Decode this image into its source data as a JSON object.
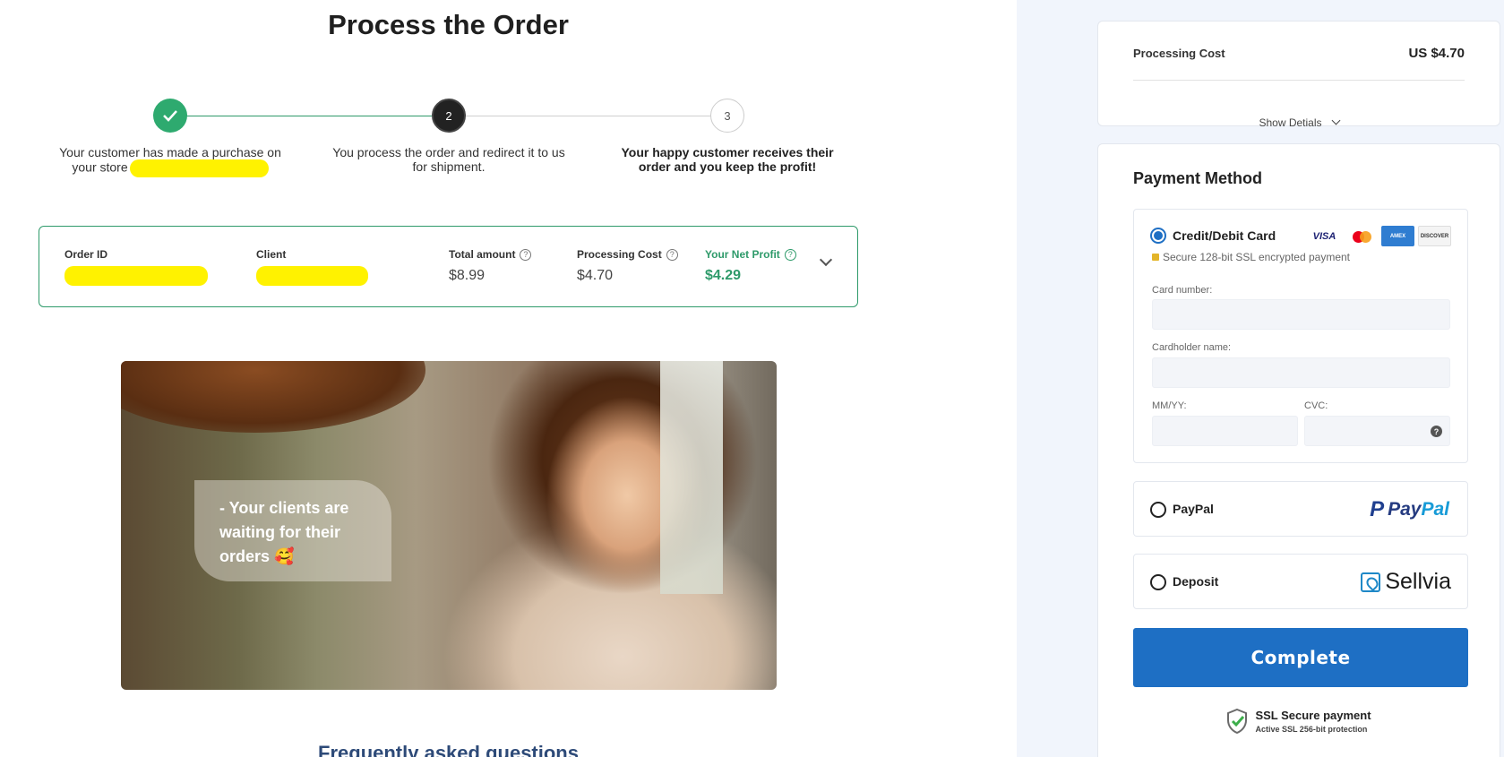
{
  "page": {
    "title": "Process the Order",
    "faq_title": "Frequently asked questions"
  },
  "stepper": {
    "steps": [
      {
        "marker": "✓",
        "text": "Your customer has made a purchase on your store"
      },
      {
        "marker": "2",
        "text": "You process the order and redirect it to us for shipment."
      },
      {
        "marker": "3",
        "text": "Your happy customer receives their order and you keep the profit!"
      }
    ]
  },
  "order": {
    "order_id_label": "Order ID",
    "client_label": "Client",
    "total_label": "Total amount",
    "total_value": "$8.99",
    "processing_label": "Processing Cost",
    "processing_value": "$4.70",
    "profit_label": "Your Net Profit",
    "profit_value": "$4.29"
  },
  "hero": {
    "bubble_text": "- Your clients are waiting for their orders 🥰"
  },
  "summary": {
    "cost_label": "Processing Cost",
    "cost_value": "US $4.70",
    "details_label": "Show Detials"
  },
  "payment": {
    "title": "Payment Method",
    "card": {
      "name": "Credit/Debit Card",
      "secure_text": "Secure 128-bit SSL encrypted payment",
      "brands": [
        "VISA",
        "Mastercard",
        "American Express",
        "DISCOVER"
      ],
      "card_number_label": "Card number:",
      "card_number_value": "",
      "holder_label": "Cardholder name:",
      "holder_value": "",
      "expiry_label": "MM/YY:",
      "expiry_value": "",
      "cvc_label": "CVC:",
      "cvc_value": "",
      "cvc_help": "?"
    },
    "paypal": {
      "name": "PayPal",
      "logo_pay": "Pay",
      "logo_pal": "Pal"
    },
    "deposit": {
      "name": "Deposit",
      "logo_text": "Sellvia"
    },
    "selected": "Credit/Debit Card",
    "complete_label": "Complete",
    "ssl_title": "SSL Secure payment",
    "ssl_subtitle": "Active SSL 256-bit protection"
  },
  "colors": {
    "accent_green": "#2e9a6a",
    "primary_blue": "#1e6fc4",
    "redaction": "#fff200",
    "sidebar_bg": "#f1f5fc"
  }
}
